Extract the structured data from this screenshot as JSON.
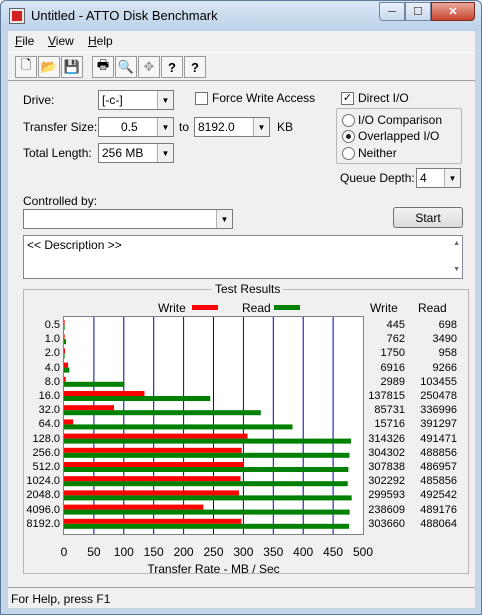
{
  "window": {
    "title": "Untitled - ATTO Disk Benchmark",
    "min": "─",
    "max": "☐",
    "close": "✕"
  },
  "menu": [
    {
      "first": "F",
      "rest": "ile"
    },
    {
      "first": "V",
      "rest": "iew"
    },
    {
      "first": "H",
      "rest": "elp"
    }
  ],
  "toolbar": {
    "new": "🗋",
    "open": "📂",
    "save": "💾",
    "print": "🖶",
    "preview": "🔍",
    "move": "✥",
    "help": "?",
    "context_help": "?"
  },
  "drive": {
    "label": "Drive:",
    "value": "[-c-]"
  },
  "transfer_size": {
    "label": "Transfer Size:",
    "from": "0.5",
    "to_label": "to",
    "to": "8192.0",
    "unit": "KB"
  },
  "total_length": {
    "label": "Total Length:",
    "value": "256 MB"
  },
  "force_write": {
    "label": "Force Write Access",
    "checked": false
  },
  "direct_io": {
    "label": "Direct I/O",
    "checked": true
  },
  "io_modes": {
    "comparison": "I/O Comparison",
    "overlapped": "Overlapped I/O",
    "neither": "Neither",
    "selected": "overlapped"
  },
  "queue_depth": {
    "label": "Queue Depth:",
    "value": "4"
  },
  "controlled_by": {
    "label": "Controlled by:",
    "value": ""
  },
  "start_button": "Start",
  "description": "<< Description >>",
  "results": {
    "title": "Test Results",
    "legend_write": "Write",
    "legend_read": "Read",
    "col_write": "Write",
    "col_read": "Read",
    "write_color": "#ff0000",
    "read_color": "#008000"
  },
  "chart_data": {
    "type": "bar",
    "title": "Test Results",
    "xlabel": "Transfer Rate - MB / Sec",
    "ylabel": "",
    "xlim": [
      0,
      500
    ],
    "xticks": [
      0,
      50,
      100,
      150,
      200,
      250,
      300,
      350,
      400,
      450,
      500
    ],
    "categories": [
      "0.5",
      "1.0",
      "2.0",
      "4.0",
      "8.0",
      "16.0",
      "32.0",
      "64.0",
      "128.0",
      "256.0",
      "512.0",
      "1024.0",
      "2048.0",
      "4096.0",
      "8192.0"
    ],
    "series": [
      {
        "name": "Write",
        "values": [
          445,
          762,
          1750,
          6916,
          2989,
          137815,
          85731,
          15716,
          314326,
          304302,
          307838,
          302292,
          299593,
          238609,
          303660
        ]
      },
      {
        "name": "Read",
        "values": [
          698,
          3490,
          958,
          9266,
          103455,
          250478,
          336996,
          391297,
          491471,
          488856,
          486957,
          485856,
          492542,
          489176,
          488064
        ]
      }
    ]
  },
  "status": "For Help, press F1"
}
